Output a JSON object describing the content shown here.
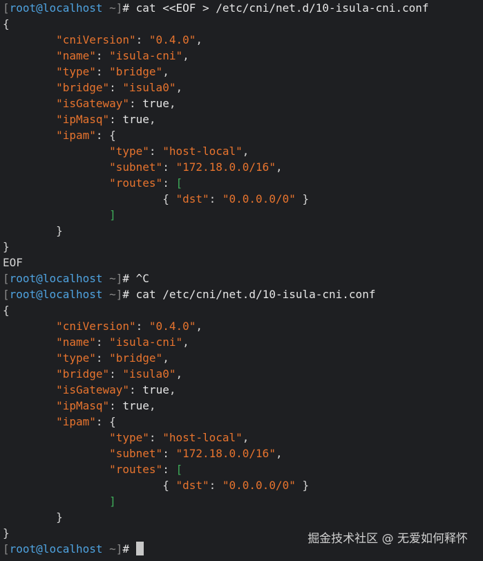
{
  "prompt": {
    "open": "[",
    "user": "root@localhost",
    "path": " ~",
    "close": "]",
    "sym": "# "
  },
  "commands": {
    "cmd1": "cat <<EOF > /etc/cni/net.d/10-isula-cni.conf",
    "cmd2": "^C",
    "cmd3": "cat /etc/cni/net.d/10-isula-cni.conf"
  },
  "eof": "EOF",
  "json": {
    "open": "{",
    "close": "}",
    "cniVersion": {
      "k": "\"cniVersion\"",
      "v": "\"0.4.0\""
    },
    "name": {
      "k": "\"name\"",
      "v": "\"isula-cni\""
    },
    "type": {
      "k": "\"type\"",
      "v": "\"bridge\""
    },
    "bridge": {
      "k": "\"bridge\"",
      "v": "\"isula0\""
    },
    "isGateway": {
      "k": "\"isGateway\"",
      "v": "true"
    },
    "ipMasq": {
      "k": "\"ipMasq\"",
      "v": "true"
    },
    "ipam": {
      "k": "\"ipam\""
    },
    "ipam_type": {
      "k": "\"type\"",
      "v": "\"host-local\""
    },
    "subnet": {
      "k": "\"subnet\"",
      "v": "\"172.18.0.0/16\""
    },
    "routes": {
      "k": "\"routes\""
    },
    "dst": {
      "k": "\"dst\"",
      "v": "\"0.0.0.0/0\""
    }
  },
  "watermark": "掘金技术社区 @ 无爱如何释怀"
}
